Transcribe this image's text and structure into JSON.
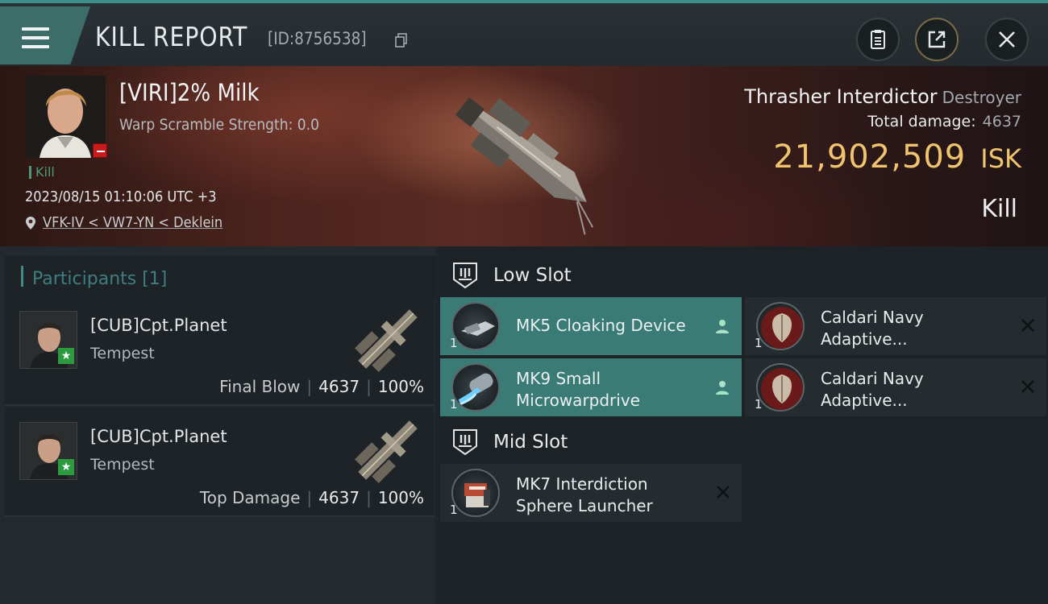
{
  "header": {
    "title": "KILL REPORT",
    "report_id": "[ID:8756538]"
  },
  "victim": {
    "name": "[VIRI]2% Milk",
    "scramble": "Warp Scramble Strength: 0.0",
    "kill_tag": "Kill",
    "datetime": "2023/08/15 01:10:06 UTC +3",
    "location": "VFK-IV < VW7-YN < Deklein"
  },
  "ship": {
    "name": "Thrasher Interdictor",
    "class": "Destroyer",
    "total_damage_label": "Total damage:",
    "total_damage": "4637",
    "isk_value": "21,902,509",
    "isk_unit": "ISK",
    "result": "Kill"
  },
  "participants": {
    "title": "Participants [1]",
    "items": [
      {
        "name": "[CUB]Cpt.Planet",
        "ship": "Tempest",
        "role": "Final Blow",
        "damage": "4637",
        "percent": "100%"
      },
      {
        "name": "[CUB]Cpt.Planet",
        "ship": "Tempest",
        "role": "Top Damage",
        "damage": "4637",
        "percent": "100%"
      }
    ]
  },
  "slots": {
    "low_slot": {
      "title": "Low Slot",
      "modules": [
        {
          "qty": "1",
          "line1": "MK5 Cloaking Device",
          "line2": "",
          "status": "fitted"
        },
        {
          "qty": "1",
          "line1": "Caldari Navy",
          "line2": "Adaptive...",
          "status": "destroyed"
        },
        {
          "qty": "1",
          "line1": "MK9 Small",
          "line2": "Microwarpdrive",
          "status": "fitted"
        },
        {
          "qty": "1",
          "line1": "Caldari Navy",
          "line2": "Adaptive...",
          "status": "destroyed"
        }
      ]
    },
    "mid_slot": {
      "title": "Mid Slot",
      "modules": [
        {
          "qty": "1",
          "line1": "MK7 Interdiction",
          "line2": "Sphere Launcher",
          "status": "destroyed"
        }
      ]
    }
  },
  "icons": {
    "menu": "menu-icon",
    "copy": "copy-icon",
    "clipboard": "clipboard-icon",
    "share": "share-icon",
    "close": "close-icon",
    "location": "location-pin-icon",
    "person": "person-icon",
    "destroyed": "x-icon",
    "slot": "slot-rack-icon"
  },
  "colors": {
    "accent_teal": "#3b7b76",
    "isk_gold": "#f0c36e",
    "kill_green": "#4f9a7e",
    "badge_red": "#c81b1b",
    "badge_green": "#2e9a3f"
  }
}
